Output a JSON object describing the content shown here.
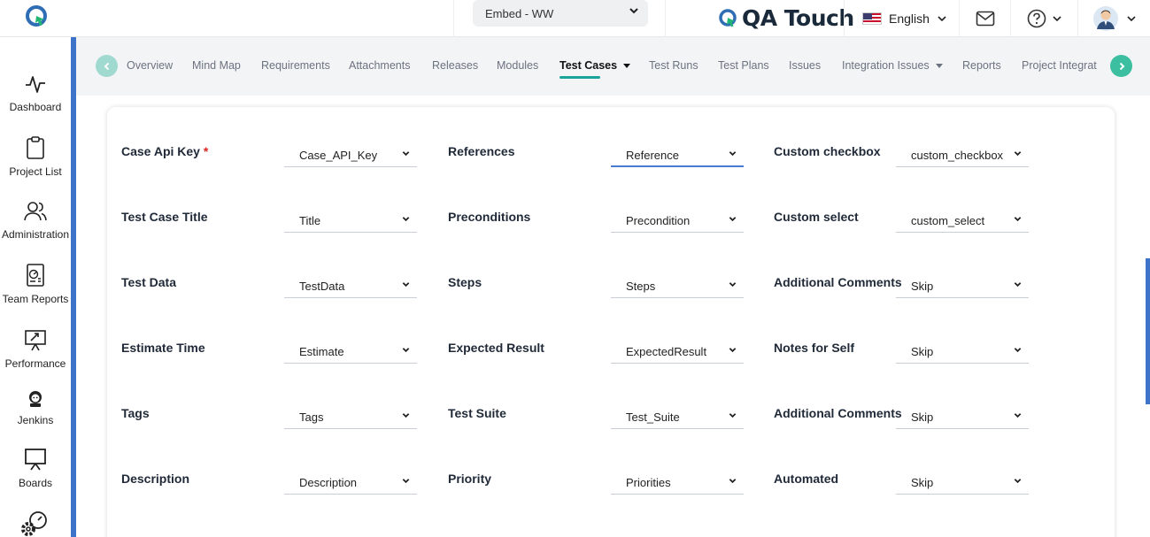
{
  "topbar": {
    "project": "Embed - WW",
    "brand": "QA Touch",
    "language": "English"
  },
  "sidebar": {
    "items": [
      {
        "label": "Dashboard",
        "icon": "pulse-icon"
      },
      {
        "label": "Project List",
        "icon": "clipboard-icon"
      },
      {
        "label": "Administration",
        "icon": "users-icon"
      },
      {
        "label": "Team Reports",
        "icon": "report-icon"
      },
      {
        "label": "Performance",
        "icon": "performance-icon"
      },
      {
        "label": "Jenkins",
        "icon": "jenkins-icon"
      },
      {
        "label": "Boards",
        "icon": "board-icon"
      }
    ]
  },
  "tabs": [
    {
      "label": "Overview"
    },
    {
      "label": "Mind Map"
    },
    {
      "label": "Requirements"
    },
    {
      "label": "Attachments"
    },
    {
      "label": "Releases"
    },
    {
      "label": "Modules"
    },
    {
      "label": "Test Cases",
      "active": true,
      "dropdown": true
    },
    {
      "label": "Test Runs"
    },
    {
      "label": "Test Plans"
    },
    {
      "label": "Issues"
    },
    {
      "label": "Integration Issues",
      "dropdown": true
    },
    {
      "label": "Reports"
    },
    {
      "label": "Project Integrat"
    }
  ],
  "mapping": {
    "required_mark": "*",
    "rows": [
      [
        {
          "label": "Case Api Key",
          "required": true,
          "value": "Case_API_Key"
        },
        {
          "label": "References",
          "value": "Reference",
          "focused": true
        },
        {
          "label": "Custom checkbox",
          "value": "custom_checkbox"
        }
      ],
      [
        {
          "label": "Test Case Title",
          "value": "Title"
        },
        {
          "label": "Preconditions",
          "value": "Precondition"
        },
        {
          "label": "Custom select",
          "value": "custom_select"
        }
      ],
      [
        {
          "label": "Test Data",
          "value": "TestData"
        },
        {
          "label": "Steps",
          "value": "Steps"
        },
        {
          "label": "Additional Comments",
          "value": "Skip"
        }
      ],
      [
        {
          "label": "Estimate Time",
          "value": "Estimate"
        },
        {
          "label": "Expected Result",
          "value": "ExpectedResult"
        },
        {
          "label": "Notes for Self",
          "value": "Skip"
        }
      ],
      [
        {
          "label": "Tags",
          "value": "Tags"
        },
        {
          "label": "Test Suite",
          "value": "Test_Suite"
        },
        {
          "label": "Additional Comments",
          "value": "Skip"
        }
      ],
      [
        {
          "label": "Description",
          "value": "Description"
        },
        {
          "label": "Priority",
          "value": "Priorities"
        },
        {
          "label": "Automated",
          "value": "Skip"
        }
      ]
    ]
  },
  "colors": {
    "accent": "#1aa39a",
    "arrow_left": "#9fd9cf",
    "arrow_right": "#3bbfa0",
    "sidebar_stripe": "#3d73c8",
    "focus": "#4a7bd0",
    "required": "#dc2626"
  }
}
